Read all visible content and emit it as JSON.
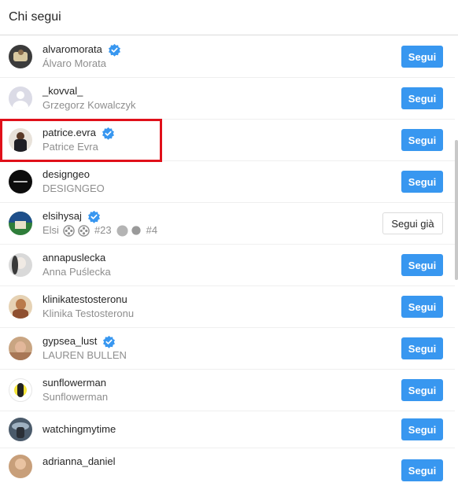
{
  "header": {
    "title": "Chi segui"
  },
  "buttons": {
    "follow": "Segui",
    "following": "Segui già"
  },
  "accounts": [
    {
      "username": "alvaromorata",
      "fullname": "Álvaro Morata",
      "verified": true,
      "state": "follow"
    },
    {
      "username": "_kovval_",
      "fullname": "Grzegorz Kowalczyk",
      "verified": false,
      "state": "follow"
    },
    {
      "username": "patrice.evra",
      "fullname": "Patrice Evra",
      "verified": true,
      "state": "follow"
    },
    {
      "username": "designgeo",
      "fullname": "DESIGNGEO",
      "verified": false,
      "state": "follow"
    },
    {
      "username": "elsihysaj",
      "fullname_parts": [
        "Elsi",
        "#23",
        "#4"
      ],
      "verified": true,
      "state": "following"
    },
    {
      "username": "annapuslecka",
      "fullname": "Anna Puślecka",
      "verified": false,
      "state": "follow"
    },
    {
      "username": "klinikatestosteronu",
      "fullname": "Klinika Testosteronu",
      "verified": false,
      "state": "follow"
    },
    {
      "username": "gypsea_lust",
      "fullname": "LAUREN BULLEN",
      "verified": true,
      "state": "follow"
    },
    {
      "username": "sunflowerman",
      "fullname": "Sunflowerman",
      "verified": false,
      "state": "follow"
    },
    {
      "username": "watchingmytime",
      "fullname": "",
      "verified": false,
      "state": "follow"
    },
    {
      "username": "adrianna_daniel",
      "fullname": "",
      "verified": false,
      "state": "follow"
    }
  ],
  "colors": {
    "accent": "#3897f0",
    "highlight": "#e0101a",
    "verified": "#3897f0"
  }
}
